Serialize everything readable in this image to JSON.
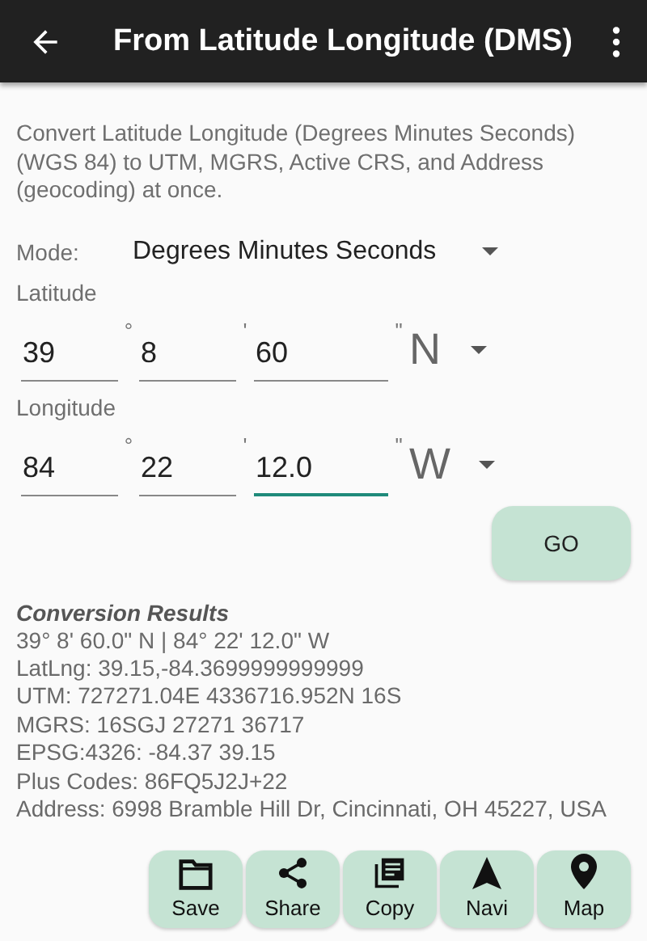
{
  "app_bar": {
    "title": "From Latitude Longitude (DMS)"
  },
  "description": "Convert Latitude Longitude (Degrees Minutes Seconds) (WGS 84) to UTM, MGRS, Active CRS, and Address (geocoding) at once.",
  "mode": {
    "label": "Mode:",
    "value": "Degrees Minutes Seconds"
  },
  "coordinates": [
    {
      "label": "Latitude",
      "fields": [
        {
          "value": "39",
          "unit": "°",
          "focused": false
        },
        {
          "value": "8",
          "unit": "'",
          "focused": false
        },
        {
          "value": "60",
          "unit": "\"",
          "focused": false
        }
      ],
      "direction": "N"
    },
    {
      "label": "Longitude",
      "fields": [
        {
          "value": "84",
          "unit": "°",
          "focused": false
        },
        {
          "value": "22",
          "unit": "'",
          "focused": false
        },
        {
          "value": "12.0",
          "unit": "\"",
          "focused": true
        }
      ],
      "direction": "W"
    }
  ],
  "go_button": "GO",
  "results": {
    "title": "Conversion Results",
    "lines": [
      "39° 8' 60.0\" N | 84° 22' 12.0\" W",
      "LatLng: 39.15,-84.3699999999999",
      "UTM: 727271.04E 4336716.952N 16S",
      "MGRS: 16SGJ 27271 36717",
      "EPSG:4326: -84.37 39.15",
      "Plus Codes: 86FQ5J2J+22",
      "Address: 6998 Bramble Hill Dr, Cincinnati, OH 45227, USA"
    ]
  },
  "actions": [
    {
      "label": "Save",
      "kind": "folder"
    },
    {
      "label": "Share",
      "kind": "share"
    },
    {
      "label": "Copy",
      "kind": "copy"
    },
    {
      "label": "Navi",
      "kind": "navigation"
    },
    {
      "label": "Map",
      "kind": "pin"
    }
  ]
}
